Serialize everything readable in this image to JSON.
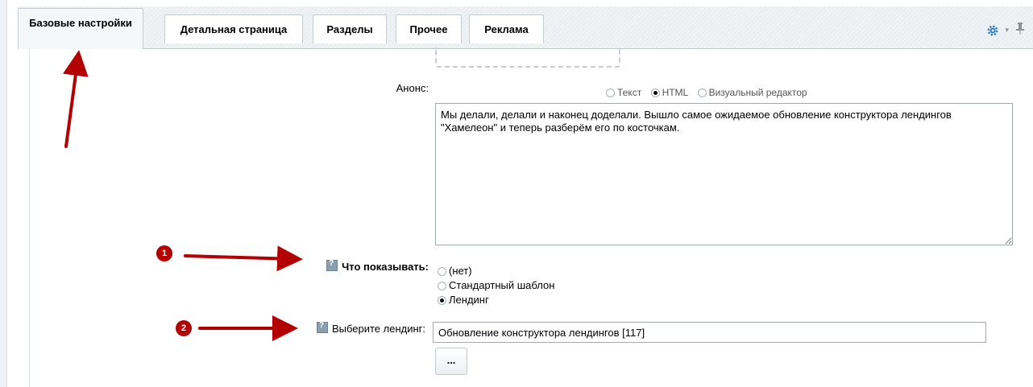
{
  "tabs": [
    {
      "label": "Базовые настройки",
      "active": true
    },
    {
      "label": "Детальная страница",
      "active": false
    },
    {
      "label": "Разделы",
      "active": false
    },
    {
      "label": "Прочее",
      "active": false
    },
    {
      "label": "Реклама",
      "active": false
    }
  ],
  "toolbar": {
    "gear_icon": "gear-icon",
    "caret": "▾",
    "pin_icon": "pin-icon"
  },
  "anons": {
    "label": "Анонс:",
    "format_options": [
      "Текст",
      "HTML",
      "Визуальный редактор"
    ],
    "format_selected": "HTML",
    "text": "Мы делали, делали и наконец доделали. Вышло самое ожидаемое обновление конструктора лендингов \"Хамелеон\" и теперь разберём его по косточкам."
  },
  "show_what": {
    "label": "Что показывать:",
    "options": [
      "(нет)",
      "Стандартный шаблон",
      "Лендинг"
    ],
    "selected": "Лендинг"
  },
  "landing": {
    "label": "Выберите лендинг:",
    "value": "Обновление конструктора лендингов [117]",
    "browse_label": "..."
  },
  "annotations": {
    "badges": [
      "1",
      "2"
    ],
    "color": "#b30000"
  }
}
